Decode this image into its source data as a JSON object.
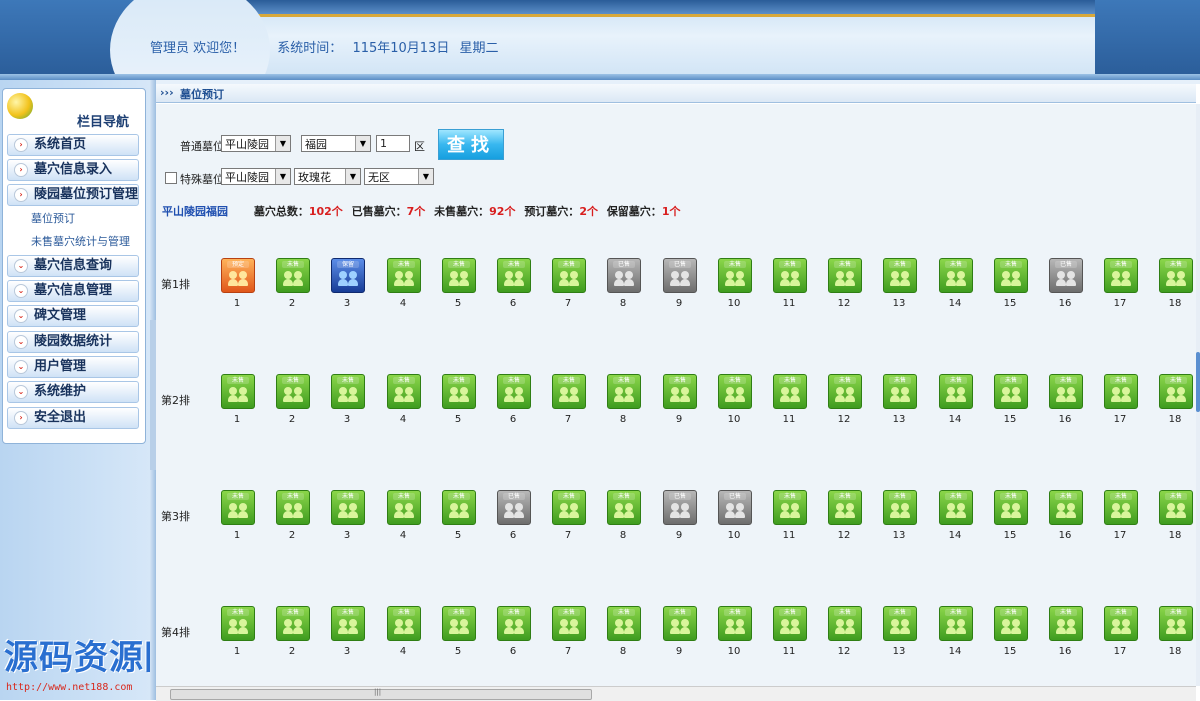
{
  "header": {
    "user": "管理员 欢迎您！",
    "time_label": "系统时间：",
    "date": "115年10月13日",
    "weekday": "星期二"
  },
  "sidebar": {
    "title": "栏目导航",
    "items": [
      {
        "label": "系统首页"
      },
      {
        "label": "墓穴信息录入"
      },
      {
        "label": "陵园墓位预订管理"
      },
      {
        "label": "墓穴信息查询"
      },
      {
        "label": "墓穴信息管理"
      },
      {
        "label": "碑文管理"
      },
      {
        "label": "陵园数据统计"
      },
      {
        "label": "用户管理"
      },
      {
        "label": "系统维护"
      },
      {
        "label": "安全退出"
      }
    ],
    "subitems": [
      {
        "label": "墓位预订"
      },
      {
        "label": "未售墓穴统计与管理"
      }
    ],
    "watermark": "源码资源网",
    "watermark_url": "http://www.net188.com"
  },
  "breadcrumb": {
    "marker": "›››",
    "title": "墓位预订"
  },
  "search": {
    "normal_label": "普通墓位",
    "normal_cemetery": "平山陵园",
    "normal_area": "福园",
    "zone_value": "1",
    "zone_suffix": "区",
    "search_button": "查找",
    "special_label": "特殊墓位",
    "special_cemetery": "平山陵园",
    "special_flower": "玫瑰花",
    "special_zone": "无区"
  },
  "summary": {
    "area_name": "平山陵园福园",
    "total_label": "墓穴总数：",
    "total": "102个",
    "sold_label": "已售墓穴：",
    "sold": "7个",
    "unsold_label": "未售墓穴：",
    "unsold": "92个",
    "booked_label": "预订墓穴：",
    "booked": "2个",
    "reserved_label": "保留墓穴：",
    "reserved": "1个"
  },
  "status_text": {
    "unsold": "未售",
    "sold": "已售",
    "booked": "预定",
    "reserved": "保留"
  },
  "colors": {
    "unsold": "#4caf27",
    "sold": "#7a7a7a",
    "booked": "#e8621d",
    "reserved": "#1f46a8",
    "highlight_number": "#d81e1e",
    "area_name": "#1f4fb0"
  },
  "grid": {
    "rows": [
      {
        "label": "第1排",
        "status": [
          "booked",
          "unsold",
          "reserved",
          "unsold",
          "unsold",
          "unsold",
          "unsold",
          "sold",
          "sold",
          "unsold",
          "unsold",
          "unsold",
          "unsold",
          "unsold",
          "unsold",
          "sold",
          "unsold",
          "unsold"
        ]
      },
      {
        "label": "第2排",
        "status": [
          "unsold",
          "unsold",
          "unsold",
          "unsold",
          "unsold",
          "unsold",
          "unsold",
          "unsold",
          "unsold",
          "unsold",
          "unsold",
          "unsold",
          "unsold",
          "unsold",
          "unsold",
          "unsold",
          "unsold",
          "unsold"
        ]
      },
      {
        "label": "第3排",
        "status": [
          "unsold",
          "unsold",
          "unsold",
          "unsold",
          "unsold",
          "sold",
          "unsold",
          "unsold",
          "sold",
          "sold",
          "unsold",
          "unsold",
          "unsold",
          "unsold",
          "unsold",
          "unsold",
          "unsold",
          "unsold"
        ]
      },
      {
        "label": "第4排",
        "status": [
          "unsold",
          "unsold",
          "unsold",
          "unsold",
          "unsold",
          "unsold",
          "unsold",
          "unsold",
          "unsold",
          "unsold",
          "unsold",
          "unsold",
          "unsold",
          "unsold",
          "unsold",
          "unsold",
          "unsold",
          "unsold"
        ]
      }
    ],
    "numbers": [
      "1",
      "2",
      "3",
      "4",
      "5",
      "6",
      "7",
      "8",
      "9",
      "10",
      "11",
      "12",
      "13",
      "14",
      "15",
      "16",
      "17",
      "18"
    ]
  }
}
